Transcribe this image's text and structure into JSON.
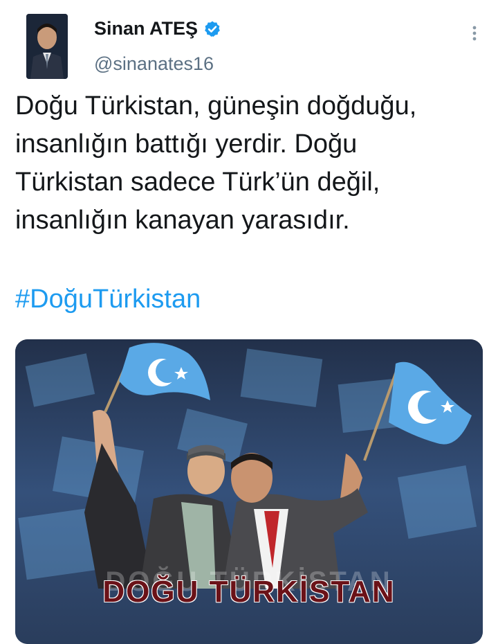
{
  "author": {
    "display_name": "Sinan ATEŞ",
    "handle": "@sinanates16",
    "verified": true
  },
  "tweet": {
    "lines": [
      "Doğu Türkistan, güneşin doğduğu,",
      "insanlığın battığı yerdir.   Doğu",
      "Türkistan sadece Türk’ün değil,",
      "insanlığın kanayan yarasıdır."
    ],
    "hashtag": "#DoğuTürkistan"
  },
  "media": {
    "caption": "DOĞU TÜRKİSTAN",
    "caption_ghost": "DOĞU TÜRKİSTAN"
  },
  "icons": {
    "verified": "verified-badge-icon",
    "more": "more-options-icon"
  },
  "colors": {
    "hashtag": "#1d9bf0",
    "verified": "#1d9bf0",
    "handle": "#5b7083",
    "flag": "#5aa9e6",
    "caption": "#6b1218"
  }
}
